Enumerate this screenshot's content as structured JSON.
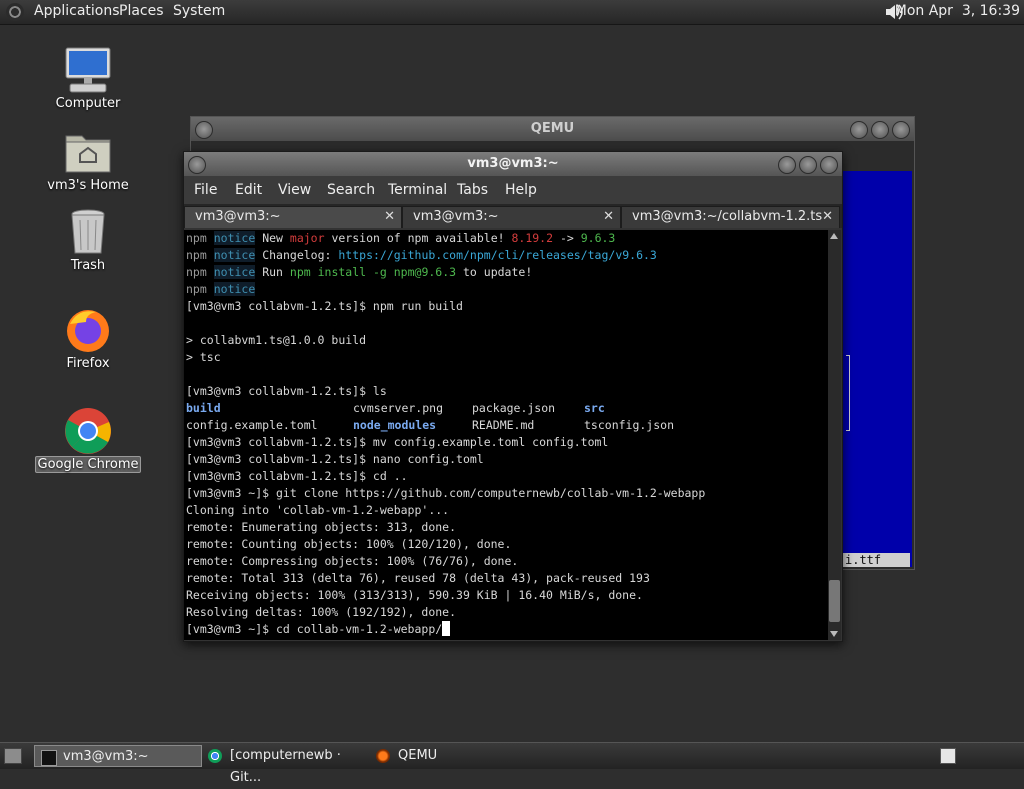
{
  "top_panel": {
    "menus": [
      "Applications",
      "Places",
      "System"
    ],
    "clock": "Mon Apr  3, 16:39"
  },
  "desktop_icons": [
    {
      "label": "Computer",
      "icon": "computer-icon"
    },
    {
      "label": "vm3's Home",
      "icon": "home-folder-icon"
    },
    {
      "label": "Trash",
      "icon": "trash-icon"
    },
    {
      "label": "Firefox",
      "icon": "firefox-icon"
    },
    {
      "label": "Google Chrome",
      "icon": "chrome-icon"
    }
  ],
  "qemu": {
    "title": "QEMU",
    "screen_text": "i.ttf",
    "screen_color": "#0000aa"
  },
  "terminal": {
    "title": "vm3@vm3:~",
    "menu": [
      "File",
      "Edit",
      "View",
      "Search",
      "Terminal",
      "Tabs",
      "Help"
    ],
    "tabs": [
      "vm3@vm3:~",
      "vm3@vm3:~",
      "vm3@vm3:~/collabvm-1.2.ts"
    ],
    "npm": "npm",
    "notice": "notice",
    "notice1": {
      "a": "New ",
      "b": "major",
      "c": " version of npm available! ",
      "d": "8.19.2",
      "e": " -> ",
      "f": "9.6.3"
    },
    "notice2": {
      "a": "Changelog: ",
      "b": "https://github.com/npm/cli/releases/tag/v9.6.3"
    },
    "notice3": {
      "a": "Run ",
      "b": "npm install -g npm@9.6.3",
      "c": " to update!"
    },
    "lines": {
      "l5": "[vm3@vm3 collabvm-1.2.ts]$ npm run build",
      "l7": "> collabvm1.ts@1.0.0 build",
      "l8": "> tsc",
      "l10": "[vm3@vm3 collabvm-1.2.ts]$ ls",
      "l15": "[vm3@vm3 collabvm-1.2.ts]$ mv config.example.toml config.toml",
      "l16": "[vm3@vm3 collabvm-1.2.ts]$ nano config.toml",
      "l17": "[vm3@vm3 collabvm-1.2.ts]$ cd ..",
      "l18": "[vm3@vm3 ~]$ git clone https://github.com/computernewb/collab-vm-1.2-webapp",
      "l19": "Cloning into 'collab-vm-1.2-webapp'...",
      "l20": "remote: Enumerating objects: 313, done.",
      "l21": "remote: Counting objects: 100% (120/120), done.",
      "l22": "remote: Compressing objects: 100% (76/76), done.",
      "l23": "remote: Total 313 (delta 76), reused 78 (delta 43), pack-reused 193",
      "l24": "Receiving objects: 100% (313/313), 590.39 KiB | 16.40 MiB/s, done.",
      "l25": "Resolving deltas: 100% (192/192), done.",
      "l26": "[vm3@vm3 ~]$ cd collab-vm-1.2-webapp/"
    },
    "ls": {
      "build": "build",
      "cvmserver": "cvmserver.png",
      "package": "package.json",
      "src": "src",
      "config_example": "config.example.toml",
      "node_modules": "node_modules",
      "readme": "README.md",
      "tsconfig": "tsconfig.json"
    }
  },
  "bottom_panel": {
    "tasks": [
      "vm3@vm3:~",
      "[computernewb · Git...",
      "QEMU"
    ]
  }
}
